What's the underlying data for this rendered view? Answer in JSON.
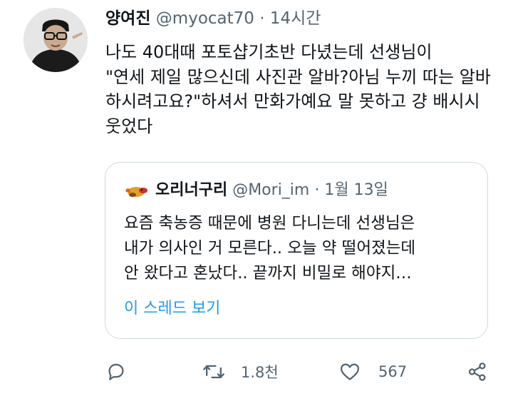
{
  "tweet": {
    "display_name": "양여진",
    "handle": "@myocat70",
    "separator": "·",
    "time": "14시간",
    "text": "나도 40대때 포토샵기초반 다녔는데 선생님이\n\"연세 제일 많으신데 사진관 알바?아님 누끼 따는 알바 하시려고요?\"하셔서 만화가예요 말 못하고 걍 배시시 웃었다"
  },
  "quote": {
    "display_name": "오리너구리",
    "handle": "@Mori_im",
    "separator": "·",
    "date": "1월 13일",
    "text": "요즘 축농증 때문에 병원 다니는데 선생님은\n내가 의사인 거 모른다.. 오늘 약 떨어졌는데\n안 왔다고 혼났다.. 끝까지 비밀로 해야지…",
    "thread_link": "이 스레드 보기"
  },
  "actions": {
    "reply_icon": "reply-icon",
    "retweet_icon": "retweet-icon",
    "retweet_count": "1.8천",
    "like_icon": "heart-icon",
    "like_count": "567",
    "share_icon": "share-icon"
  },
  "colors": {
    "text": "#0f1419",
    "muted": "#536471",
    "link": "#1d9bf0",
    "border": "#cfd9de"
  }
}
